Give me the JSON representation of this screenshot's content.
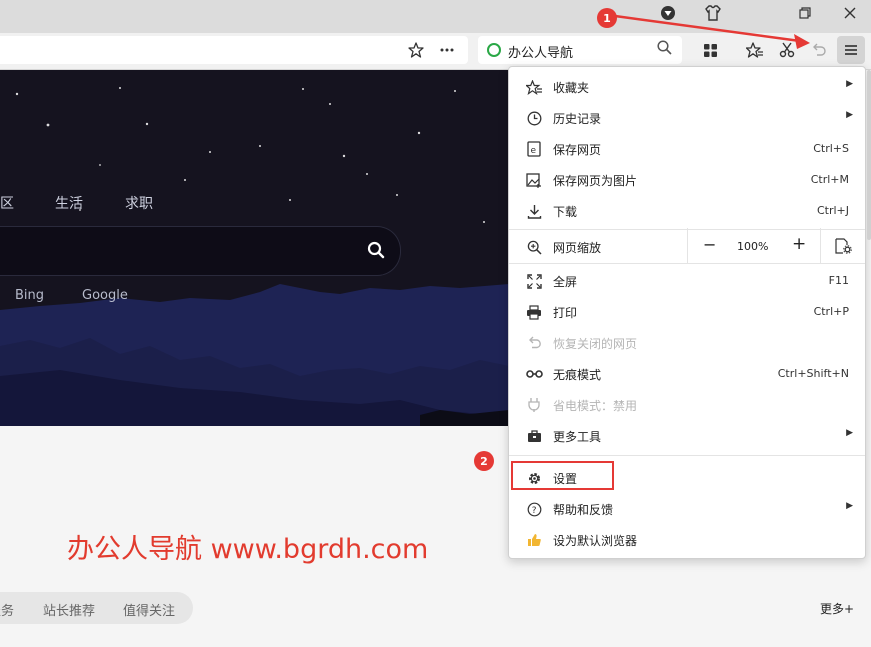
{
  "titlebar": {
    "icons": [
      "vpn-shield-icon",
      "skin-shirt-icon",
      "restore-window-icon",
      "close-window-icon"
    ]
  },
  "toolbar": {
    "star_icon": "bookmark-star-icon",
    "more_icon": "ellipsis-icon",
    "search_box": {
      "text": "办公人导航"
    },
    "icons": [
      "apps-grid-icon",
      "favorites-icon",
      "screenshot-scissors-icon",
      "undo-icon",
      "menu-hamburger-icon"
    ]
  },
  "hero": {
    "categories": [
      "区",
      "生活",
      "求职"
    ],
    "engines": [
      "Bing",
      "Google"
    ]
  },
  "watermark": {
    "text": "办公人导航 www.bgrdh.com"
  },
  "bottom_pill": {
    "items": [
      "服务",
      "站长推荐",
      "值得关注"
    ]
  },
  "more_link": "更多+",
  "markers": {
    "one": "1",
    "two": "2"
  },
  "menu": {
    "favorites": {
      "label": "收藏夹"
    },
    "history": {
      "label": "历史记录"
    },
    "save_page": {
      "label": "保存网页",
      "shortcut": "Ctrl+S"
    },
    "save_image": {
      "label": "保存网页为图片",
      "shortcut": "Ctrl+M"
    },
    "download": {
      "label": "下载",
      "shortcut": "Ctrl+J"
    },
    "zoom": {
      "label": "网页缩放",
      "minus": "−",
      "value": "100%",
      "plus": "+"
    },
    "fullscreen": {
      "label": "全屏",
      "shortcut": "F11"
    },
    "print": {
      "label": "打印",
      "shortcut": "Ctrl+P"
    },
    "restore_closed": {
      "label": "恢复关闭的网页"
    },
    "incognito": {
      "label": "无痕模式",
      "shortcut": "Ctrl+Shift+N"
    },
    "power_save": {
      "label": "省电模式：禁用"
    },
    "more_tools": {
      "label": "更多工具"
    },
    "settings": {
      "label": "设置"
    },
    "help": {
      "label": "帮助和反馈"
    },
    "default_browser": {
      "label": "设为默认浏览器"
    }
  },
  "colors": {
    "accent_red": "#e53935",
    "hero_bg": "#15131f",
    "mountain": "#1e2354",
    "watermark": "#e23b2e"
  }
}
